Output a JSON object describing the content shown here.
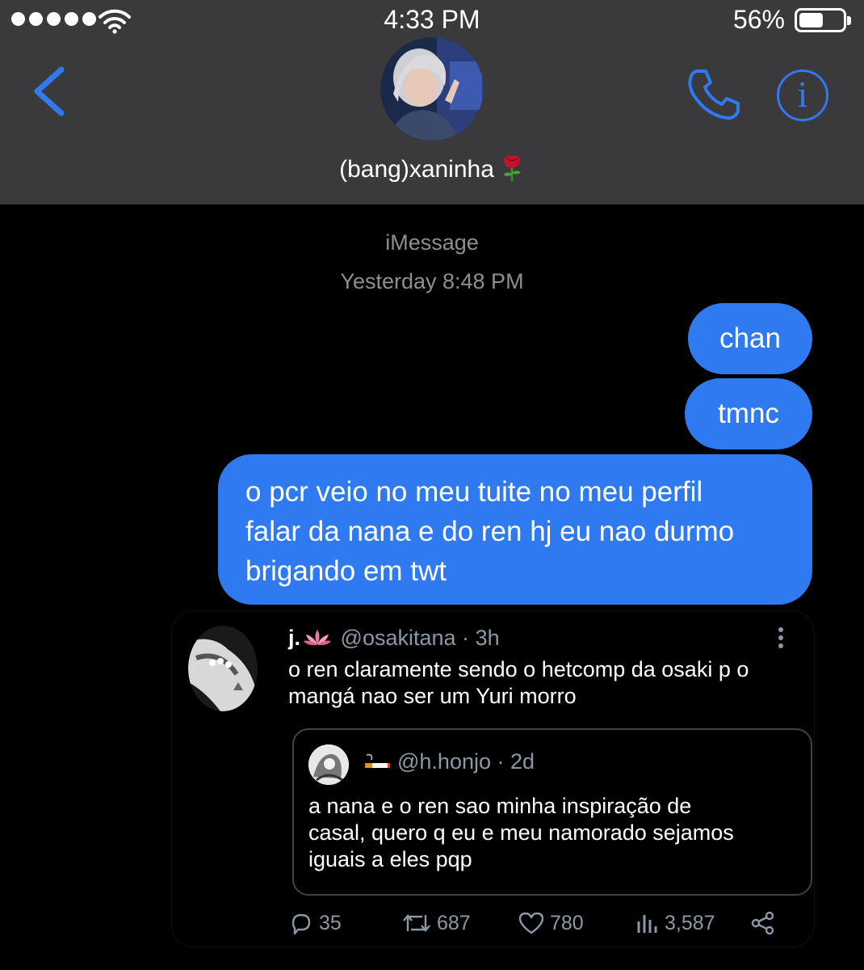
{
  "status_bar": {
    "time": "4:33 PM",
    "battery_percent": "56%",
    "battery_level": 0.56,
    "signal_bars": 5
  },
  "header": {
    "contact_name": "(bang)xaninha",
    "contact_emoji": "rose-emoji",
    "back_icon": "chevron-left-icon",
    "call_icon": "phone-icon",
    "info_icon": "info-icon",
    "info_glyph": "i",
    "accent_color": "#2f7af0",
    "background_color": "#3a3a3c"
  },
  "conversation": {
    "service": "iMessage",
    "timestamp": "Yesterday 8:48 PM",
    "bubble_color": "#2f7af0",
    "messages": [
      {
        "direction": "outgoing",
        "text": "chan"
      },
      {
        "direction": "outgoing",
        "text": "tmnc"
      },
      {
        "direction": "outgoing",
        "lines": [
          "o pcr veio no meu tuite no meu perfil",
          "falar da nana e do ren hj eu nao durmo",
          "brigando em twt"
        ]
      }
    ]
  },
  "tweet": {
    "name": "j.",
    "name_emoji": "lotus-emoji",
    "handle": "@osakitana",
    "time": "3h",
    "lines": [
      "o ren claramente sendo o hetcomp da osaki p o",
      "mangá nao ser um Yuri morro"
    ],
    "quote": {
      "name_emoji": "cigarette-emoji",
      "handle": "@h.honjo",
      "time": "2d",
      "lines": [
        "a nana e o ren sao minha inspiração de",
        "casal, quero q eu e meu namorado sejamos",
        "iguais a eles pqp"
      ]
    },
    "stats": {
      "replies": "35",
      "retweets": "687",
      "likes": "780",
      "views": "3,587"
    }
  }
}
